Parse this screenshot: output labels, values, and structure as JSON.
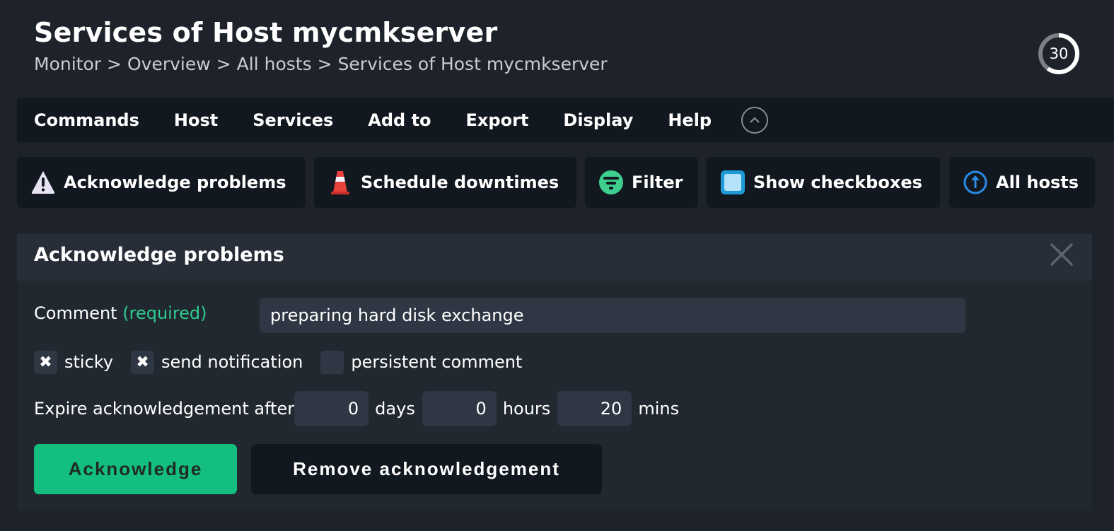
{
  "header": {
    "title": "Services of Host mycmkserver",
    "breadcrumb": [
      "Monitor",
      "Overview",
      "All hosts",
      "Services of Host mycmkserver"
    ],
    "breadcrumb_separator": ">",
    "reload_countdown": "30",
    "reload_progress": 0.6
  },
  "menubar": {
    "items": [
      "Commands",
      "Host",
      "Services",
      "Add to",
      "Export",
      "Display",
      "Help"
    ],
    "toggle_icon": "chevron-up-icon"
  },
  "shortcuts": [
    {
      "label": "Acknowledge problems",
      "icon": "warning-icon"
    },
    {
      "label": "Schedule downtimes",
      "icon": "traffic-cone-icon"
    },
    {
      "label": "Filter",
      "icon": "filter-icon"
    },
    {
      "label": "Show checkboxes",
      "icon": "checkbox-icon"
    },
    {
      "label": "All hosts",
      "icon": "arrow-up-circle-icon"
    }
  ],
  "panel": {
    "title": "Acknowledge problems",
    "comment_label": "Comment",
    "comment_required": "(required)",
    "comment_value": "preparing hard disk exchange",
    "checkboxes": [
      {
        "label": "sticky",
        "checked": true
      },
      {
        "label": "send notification",
        "checked": true
      },
      {
        "label": "persistent comment",
        "checked": false
      }
    ],
    "expire_label": "Expire acknowledgement after",
    "expire": {
      "days": "0",
      "days_unit": "days",
      "hours": "0",
      "hours_unit": "hours",
      "mins": "20",
      "mins_unit": "mins"
    },
    "acknowledge_button": "Acknowledge",
    "remove_button": "Remove acknowledgement"
  },
  "colors": {
    "accent_green": "#13be7e",
    "required_green": "#2fcb8e",
    "filter_green": "#3ecf8e",
    "cone_red": "#e8413b",
    "info_blue": "#2a8ae6",
    "checkbox_blue": "#1e9bd7"
  }
}
